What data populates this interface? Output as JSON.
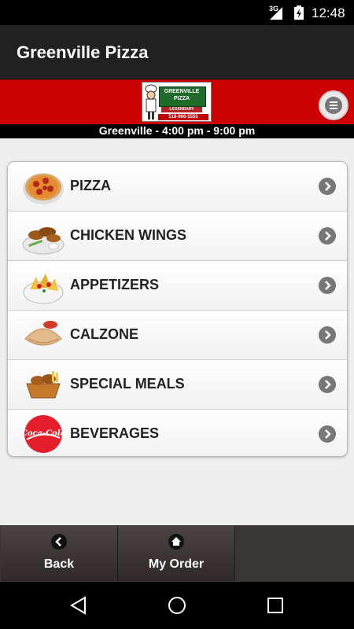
{
  "status_bar": {
    "network": "3G",
    "time": "12:48"
  },
  "app_bar": {
    "title": "Greenville Pizza"
  },
  "brand": {
    "logo_name": "GREENVILLE PIZZA",
    "logo_banner": "LEGENDARY",
    "logo_phone": "518-966-5555",
    "hours": "Greenville - 4:00 pm - 9:00 pm"
  },
  "menu": {
    "items": [
      {
        "label": "PIZZA",
        "icon": "pizza-icon"
      },
      {
        "label": "CHICKEN WINGS",
        "icon": "chicken-wings-icon"
      },
      {
        "label": "APPETIZERS",
        "icon": "appetizers-icon"
      },
      {
        "label": "CALZONE",
        "icon": "calzone-icon"
      },
      {
        "label": "SPECIAL MEALS",
        "icon": "special-meals-icon"
      },
      {
        "label": "BEVERAGES",
        "icon": "coca-cola-icon"
      }
    ]
  },
  "bottom_nav": {
    "back_label": "Back",
    "my_order_label": "My Order"
  },
  "colors": {
    "brand_red": "#cc0000",
    "app_bar": "#212121",
    "arrow_gray": "#777777"
  }
}
